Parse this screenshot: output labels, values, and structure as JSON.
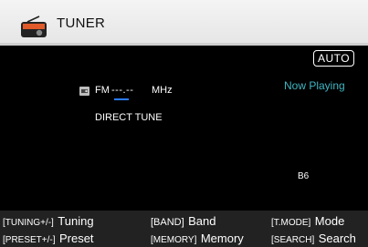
{
  "header": {
    "title": "TUNER",
    "icon": "radio-icon"
  },
  "main": {
    "mode": "AUTO",
    "now_playing": "Now Playing",
    "band": "FM",
    "frequency": "---.--",
    "unit": "MHz",
    "tune_mode": "DIRECT TUNE",
    "preset_no": "B6"
  },
  "guide": {
    "row1": [
      {
        "key": "[TUNING+/-]",
        "action": "Tuning"
      },
      {
        "key": "[BAND]",
        "action": "Band"
      },
      {
        "key": "[T.MODE]",
        "action": "Mode"
      }
    ],
    "row2": [
      {
        "key": "[PRESET+/-]",
        "action": "Preset"
      },
      {
        "key": "[MEMORY]",
        "action": "Memory"
      },
      {
        "key": "[SEARCH]",
        "action": "Search"
      }
    ]
  },
  "colors": {
    "header_bg": "#f0f0f0",
    "background": "#000000",
    "now_playing": "#3fb6c3",
    "cursor": "#2a7bff",
    "guide_bg": "#222222"
  }
}
